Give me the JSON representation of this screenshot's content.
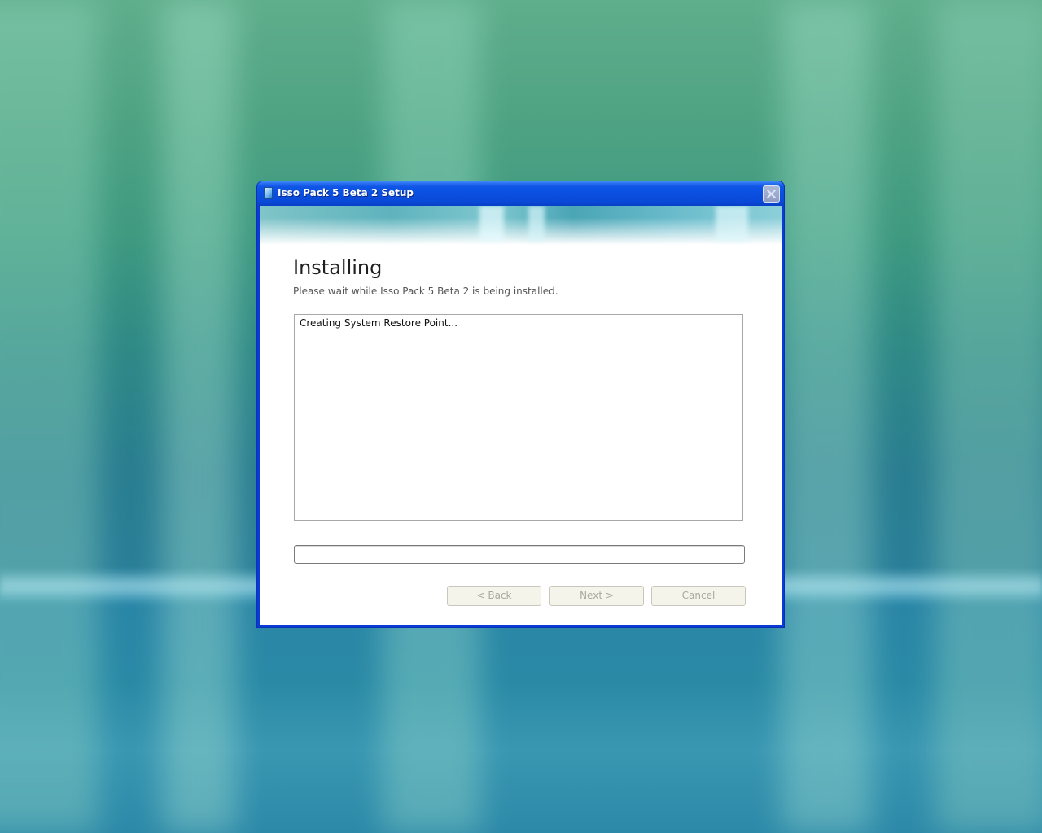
{
  "window": {
    "title": "Isso Pack 5 Beta 2 Setup",
    "icon": "installer-icon",
    "close_icon": "close-icon"
  },
  "page": {
    "heading": "Installing",
    "subheading": "Please wait while Isso Pack 5 Beta 2 is being installed."
  },
  "log": {
    "lines": [
      "Creating System Restore Point..."
    ]
  },
  "progress": {
    "value": 0
  },
  "buttons": {
    "back": "< Back",
    "next": "Next >",
    "cancel": "Cancel"
  },
  "colors": {
    "titlebar": "#0a4fe0",
    "window_border": "#0a3bd6",
    "button_face": "#f5f4ea",
    "disabled_text": "#a8a8a0"
  }
}
